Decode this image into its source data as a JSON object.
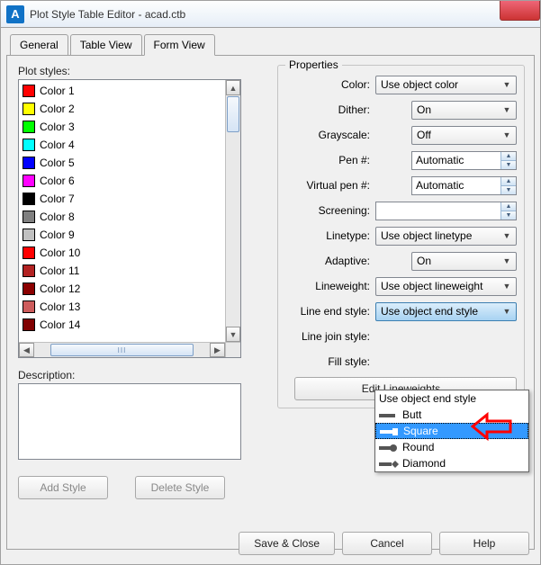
{
  "window": {
    "title": "Plot Style Table Editor - acad.ctb",
    "appicon_text": "A"
  },
  "tabs": {
    "general": "General",
    "table_view": "Table View",
    "form_view": "Form View"
  },
  "plot_styles": {
    "label": "Plot styles:",
    "items": [
      {
        "name": "Color 1",
        "color": "#ff0000"
      },
      {
        "name": "Color 2",
        "color": "#ffff00"
      },
      {
        "name": "Color 3",
        "color": "#00ff00"
      },
      {
        "name": "Color 4",
        "color": "#00ffff"
      },
      {
        "name": "Color 5",
        "color": "#0000ff"
      },
      {
        "name": "Color 6",
        "color": "#ff00ff"
      },
      {
        "name": "Color 7",
        "color": "#000000"
      },
      {
        "name": "Color 8",
        "color": "#808080"
      },
      {
        "name": "Color 9",
        "color": "#c0c0c0"
      },
      {
        "name": "Color 10",
        "color": "#ff0000"
      },
      {
        "name": "Color 11",
        "color": "#b22222"
      },
      {
        "name": "Color 12",
        "color": "#8b0000"
      },
      {
        "name": "Color 13",
        "color": "#cd5c5c"
      },
      {
        "name": "Color 14",
        "color": "#800000"
      }
    ]
  },
  "description": {
    "label": "Description:",
    "value": ""
  },
  "buttons": {
    "add_style": "Add Style",
    "delete_style": "Delete Style",
    "edit_lineweights": "Edit Lineweights...",
    "save_close": "Save & Close",
    "cancel": "Cancel",
    "help": "Help"
  },
  "properties": {
    "legend": "Properties",
    "color": {
      "label": "Color:",
      "value": "Use object color"
    },
    "dither": {
      "label": "Dither:",
      "value": "On"
    },
    "grayscale": {
      "label": "Grayscale:",
      "value": "Off"
    },
    "pen": {
      "label": "Pen #:",
      "value": "Automatic"
    },
    "virtual_pen": {
      "label": "Virtual pen #:",
      "value": "Automatic"
    },
    "screening": {
      "label": "Screening:",
      "value": ""
    },
    "linetype": {
      "label": "Linetype:",
      "value": "Use object linetype"
    },
    "adaptive": {
      "label": "Adaptive:",
      "value": "On"
    },
    "lineweight": {
      "label": "Lineweight:",
      "value": "Use object lineweight"
    },
    "end_style": {
      "label": "Line end style:",
      "value": "Use object end style"
    },
    "join_style": {
      "label": "Line join style:"
    },
    "fill_style": {
      "label": "Fill style:"
    }
  },
  "end_style_options": {
    "opt0": "Use object end style",
    "opt1": "Butt",
    "opt2": "Square",
    "opt3": "Round",
    "opt4": "Diamond"
  }
}
